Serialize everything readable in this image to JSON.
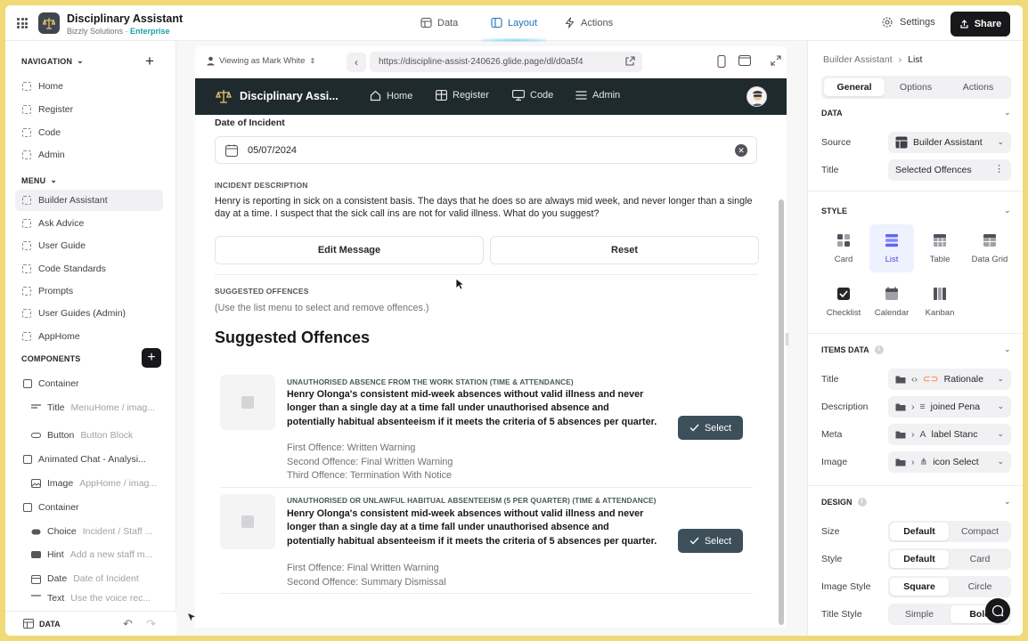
{
  "app": {
    "title": "Disciplinary Assistant",
    "org": "Bizzly Solutions · ",
    "plan": "Enterprise"
  },
  "topbar": {
    "tabs": [
      {
        "label": "Data",
        "icon": "database-icon"
      },
      {
        "label": "Layout",
        "icon": "layout-icon",
        "active": true
      },
      {
        "label": "Actions",
        "icon": "lightning-icon"
      }
    ],
    "settings_label": "Settings",
    "share_label": "Share"
  },
  "sidebar": {
    "navigation_header": "NAVIGATION",
    "navigation_items": [
      "Home",
      "Register",
      "Code",
      "Admin"
    ],
    "menu_header": "MENU",
    "menu_items": [
      "Builder Assistant",
      "Ask Advice",
      "User Guide",
      "Code Standards",
      "Prompts",
      "User Guides (Admin)",
      "AppHome"
    ],
    "components_header": "COMPONENTS",
    "components": [
      {
        "label": "Container",
        "sub": "",
        "icon": "container-icon"
      },
      {
        "label": "Title",
        "sub": "MenuHome / imag...",
        "icon": "title-icon"
      },
      {
        "label": "Button",
        "sub": "Button Block",
        "icon": "button-icon"
      },
      {
        "label": "Animated Chat - Analysi...",
        "sub": "",
        "icon": "container-icon"
      },
      {
        "label": "Image",
        "sub": "AppHome / imag...",
        "icon": "image-icon"
      },
      {
        "label": "Container",
        "sub": "",
        "icon": "container-icon"
      },
      {
        "label": "Choice",
        "sub": "Incident / Staff ...",
        "icon": "choice-icon"
      },
      {
        "label": "Hint",
        "sub": "Add a new staff m...",
        "icon": "hint-icon"
      },
      {
        "label": "Date",
        "sub": "Date of Incident",
        "icon": "date-icon"
      },
      {
        "label": "Text",
        "sub": "Use the voice rec...",
        "icon": "text-icon"
      }
    ],
    "bottom_label": "DATA"
  },
  "preview": {
    "viewing_as": "Viewing as Mark White",
    "url": "https://discipline-assist-240626.glide.page/dl/d0a5f4",
    "header": {
      "title": "Disciplinary Assi...",
      "tabs": [
        "Home",
        "Register",
        "Code",
        "Admin"
      ]
    },
    "date_label": "Date of Incident",
    "date_value": "05/07/2024",
    "incident_caption": "INCIDENT DESCRIPTION",
    "incident_text": "Henry is reporting in sick on a consistent basis. The days that he does so are always mid week, and never longer than a single day at a time. I suspect that the sick call ins are not for valid illness. What do you suggest?",
    "edit_label": "Edit Message",
    "reset_label": "Reset",
    "suggested_caption": "SUGGESTED OFFENCES",
    "suggested_hint": "(Use the list menu to select and remove offences.)",
    "list_title": "Suggested Offences",
    "offences": [
      {
        "meta": "UNAUTHORISED ABSENCE FROM THE WORK STATION (TIME & ATTENDANCE)",
        "title": "Henry Olonga's consistent mid-week absences without valid illness and never longer than a single day at a time fall under unauthorised absence and potentially habitual absenteeism if it meets the criteria of 5 absences per quarter.",
        "lines": [
          "First Offence: Written Warning",
          "Second Offence: Final Written Warning",
          "Third Offence: Termination With Notice"
        ],
        "button": "Select"
      },
      {
        "meta": "UNAUTHORISED OR UNLAWFUL HABITUAL ABSENTEEISM (5 PER QUARTER) (TIME & ATTENDANCE)",
        "title": "Henry Olonga's consistent mid-week absences without valid illness and never longer than a single day at a time fall under unauthorised absence and potentially habitual absenteeism if it meets the criteria of 5 absences per quarter.",
        "lines": [
          "First Offence: Final Written Warning",
          "Second Offence: Summary Dismissal"
        ],
        "button": "Select"
      }
    ]
  },
  "panel": {
    "breadcrumb": [
      "Builder Assistant",
      "›",
      "List"
    ],
    "tabs": [
      "General",
      "Options",
      "Actions"
    ],
    "data_header": "DATA",
    "source_label": "Source",
    "source_value": "Builder Assistant",
    "title_label": "Title",
    "title_value": "Selected Offences",
    "style_header": "STYLE",
    "styles": [
      "Card",
      "List",
      "Table",
      "Data Grid",
      "Checklist",
      "Calendar",
      "Kanban"
    ],
    "selected_style": "List",
    "items_header": "ITEMS DATA",
    "items": [
      {
        "label": "Title",
        "value": "Rationale"
      },
      {
        "label": "Description",
        "value": "joined Pena"
      },
      {
        "label": "Meta",
        "value": "label Stanc"
      },
      {
        "label": "Image",
        "value": "icon Select"
      }
    ],
    "design_header": "DESIGN",
    "design": [
      {
        "label": "Size",
        "options": [
          "Default",
          "Compact"
        ],
        "selected": "Default"
      },
      {
        "label": "Style",
        "options": [
          "Default",
          "Card"
        ],
        "selected": "Default"
      },
      {
        "label": "Image Style",
        "options": [
          "Square",
          "Circle"
        ],
        "selected": "Square"
      },
      {
        "label": "Title Style",
        "options": [
          "Simple",
          "Bold"
        ],
        "selected": "Bold"
      }
    ]
  },
  "colors": {
    "accent": "#4f46e5",
    "header_bg": "#1f2a2f",
    "select_btn": "#3c4f5a",
    "layout_tab": "#1d6fbd",
    "enterprise": "#14a3a3"
  }
}
